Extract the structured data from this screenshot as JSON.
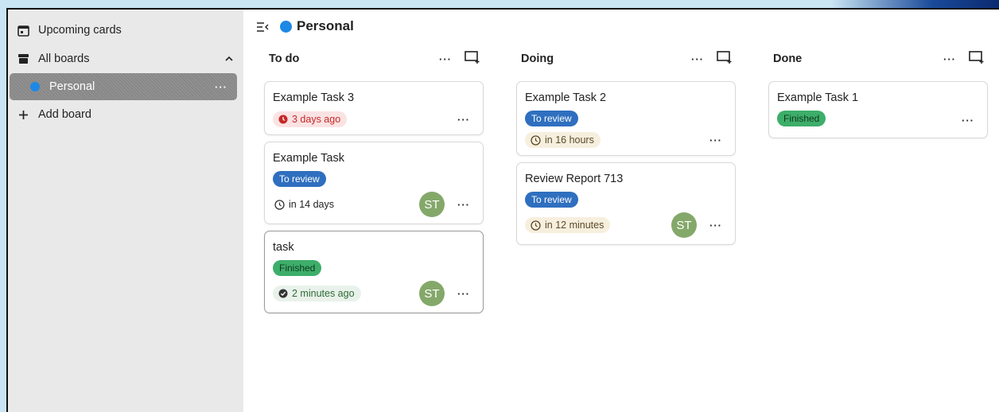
{
  "colors": {
    "board_dot": "#1e88e5",
    "tag_to_review": "#2f6fbf",
    "tag_finished": "#3dae6a",
    "badge_overdue_bg": "#fbe3e3",
    "badge_overdue_fg": "#c62828",
    "badge_upcoming_bg": "#f7efde",
    "badge_done_bg": "#e9f2ea",
    "badge_done_fg": "#2e6b36",
    "avatar_bg": "#84a86a"
  },
  "sidebar": {
    "items": [
      {
        "label": "Upcoming cards",
        "icon": "calendar-icon"
      },
      {
        "label": "All boards",
        "icon": "archive-icon"
      },
      {
        "label": "Personal",
        "icon": "board-dot"
      },
      {
        "label": "Add board",
        "icon": "plus-icon"
      }
    ]
  },
  "board": {
    "title": "Personal"
  },
  "columns": [
    {
      "title": "To do",
      "cards": [
        {
          "title": "Example Task 3",
          "badge": "3 days ago"
        },
        {
          "title": "Example Task",
          "tag": "To review",
          "badge": "in 14 days",
          "avatar": "ST"
        },
        {
          "title": "task",
          "tag": "Finished",
          "badge": "2 minutes ago",
          "avatar": "ST"
        }
      ]
    },
    {
      "title": "Doing",
      "cards": [
        {
          "title": "Example Task 2",
          "tag": "To review",
          "badge": "in 16 hours"
        },
        {
          "title": "Review Report 713",
          "tag": "To review",
          "badge": "in 12 minutes",
          "avatar": "ST"
        }
      ]
    },
    {
      "title": "Done",
      "cards": [
        {
          "title": "Example Task 1",
          "tag": "Finished"
        }
      ]
    }
  ],
  "more_label": "···"
}
